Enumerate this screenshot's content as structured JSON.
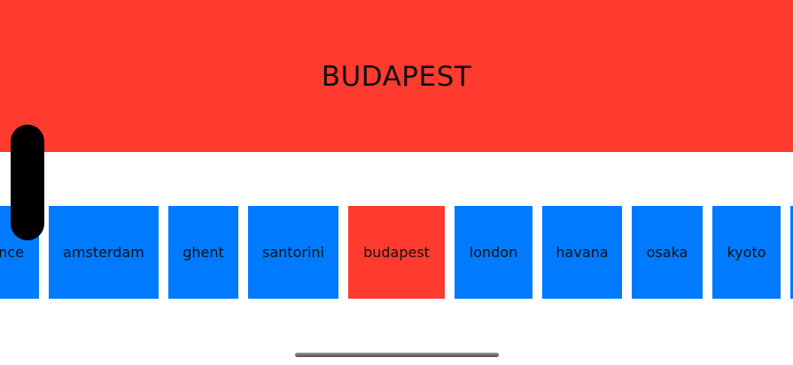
{
  "banner": {
    "title": "BUDAPEST",
    "color": "#ff3b30"
  },
  "cities": [
    {
      "label": "nce",
      "selected": false
    },
    {
      "label": "amsterdam",
      "selected": false
    },
    {
      "label": "ghent",
      "selected": false
    },
    {
      "label": "santorini",
      "selected": false
    },
    {
      "label": "budapest",
      "selected": true
    },
    {
      "label": "london",
      "selected": false
    },
    {
      "label": "havana",
      "selected": false
    },
    {
      "label": "osaka",
      "selected": false
    },
    {
      "label": "kyoto",
      "selected": false
    },
    {
      "label": "",
      "selected": false
    }
  ],
  "colors": {
    "item": "#007aff",
    "selected_item": "#ff3b30"
  }
}
